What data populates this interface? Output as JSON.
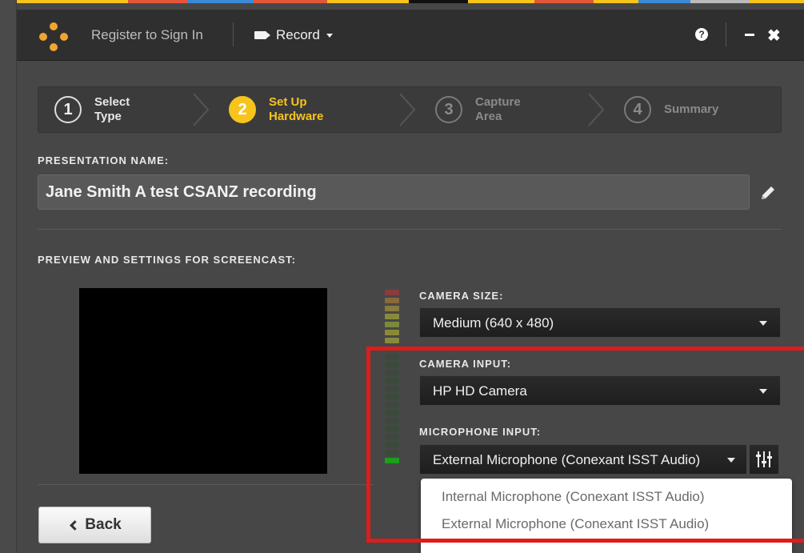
{
  "header": {
    "register_label": "Register to Sign In",
    "record_label": "Record",
    "help_symbol": "?",
    "close_symbol": "✖",
    "stripe_colors": [
      "#f7c41c",
      "#f7c41c",
      "#e4563a",
      "#3b8ad8",
      "#e4563a",
      "#f7c41c",
      "#111111",
      "#f7c41c",
      "#e4563a",
      "#f7c41c",
      "#3b8ad8",
      "#bbbbbb",
      "#f7c41c"
    ]
  },
  "steps": [
    {
      "num": "1",
      "line1": "Select",
      "line2": "Type",
      "state": "done"
    },
    {
      "num": "2",
      "line1": "Set Up",
      "line2": "Hardware",
      "state": "active"
    },
    {
      "num": "3",
      "line1": "Capture",
      "line2": "Area",
      "state": "pending"
    },
    {
      "num": "4",
      "line1": "Summary",
      "line2": "",
      "state": "pending"
    }
  ],
  "presentation": {
    "label": "PRESENTATION NAME:",
    "value": "Jane Smith A test CSANZ recording"
  },
  "preview": {
    "label": "PREVIEW AND SETTINGS FOR SCREENCAST:"
  },
  "camera_size": {
    "label": "CAMERA SIZE:",
    "value": "Medium (640 x 480)"
  },
  "camera_input": {
    "label": "CAMERA INPUT:",
    "value": "HP HD Camera"
  },
  "microphone_input": {
    "label": "MICROPHONE INPUT:",
    "value": "External Microphone (Conexant ISST Audio)",
    "options": [
      "Internal Microphone (Conexant ISST Audio)",
      "External Microphone (Conexant ISST Audio)"
    ]
  },
  "footer": {
    "back_label": "Back"
  },
  "colors": {
    "accent": "#f7c41c",
    "highlight": "#e01b1b",
    "brand_logo": "#f0a530"
  }
}
